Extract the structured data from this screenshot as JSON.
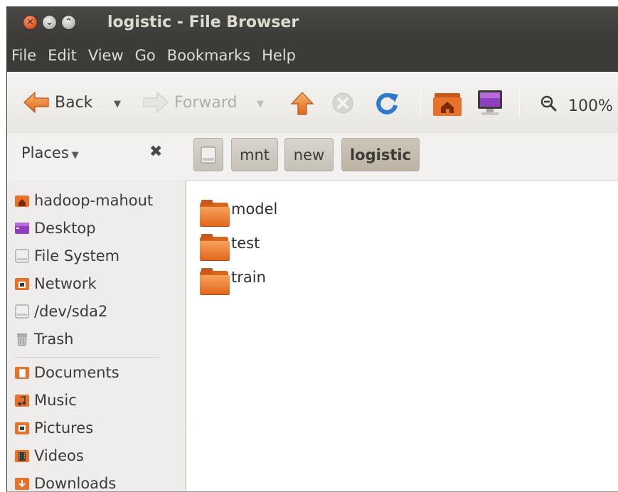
{
  "window": {
    "title": "logistic - File Browser"
  },
  "menubar": {
    "items": [
      "File",
      "Edit",
      "View",
      "Go",
      "Bookmarks",
      "Help"
    ]
  },
  "toolbar": {
    "back_label": "Back",
    "forward_label": "Forward",
    "zoom_label": "100%",
    "icons": [
      "back-arrow-icon",
      "forward-arrow-icon",
      "up-arrow-icon",
      "stop-icon",
      "reload-icon",
      "home-icon",
      "computer-icon",
      "zoom-icon"
    ]
  },
  "sidebar": {
    "header": "Places",
    "places": [
      {
        "label": "hadoop-mahout",
        "icon": "home-folder-icon"
      },
      {
        "label": "Desktop",
        "icon": "desktop-icon"
      },
      {
        "label": "File System",
        "icon": "drive-icon"
      },
      {
        "label": "Network",
        "icon": "network-icon"
      },
      {
        "label": "/dev/sda2",
        "icon": "drive-icon"
      },
      {
        "label": "Trash",
        "icon": "trash-icon"
      }
    ],
    "bookmarks": [
      {
        "label": "Documents",
        "icon": "documents-icon"
      },
      {
        "label": "Music",
        "icon": "music-icon"
      },
      {
        "label": "Pictures",
        "icon": "pictures-icon"
      },
      {
        "label": "Videos",
        "icon": "videos-icon"
      },
      {
        "label": "Downloads",
        "icon": "downloads-icon"
      }
    ]
  },
  "pathbar": {
    "crumbs": [
      "mnt",
      "new",
      "logistic"
    ],
    "root_icon": "drive-icon"
  },
  "files": [
    {
      "name": "model",
      "icon": "folder-icon"
    },
    {
      "name": "test",
      "icon": "folder-icon"
    },
    {
      "name": "train",
      "icon": "folder-icon"
    }
  ],
  "colors": {
    "accent_orange": "#e2661d",
    "titlebar": "#3c3b37",
    "text": "#3c3b37"
  }
}
